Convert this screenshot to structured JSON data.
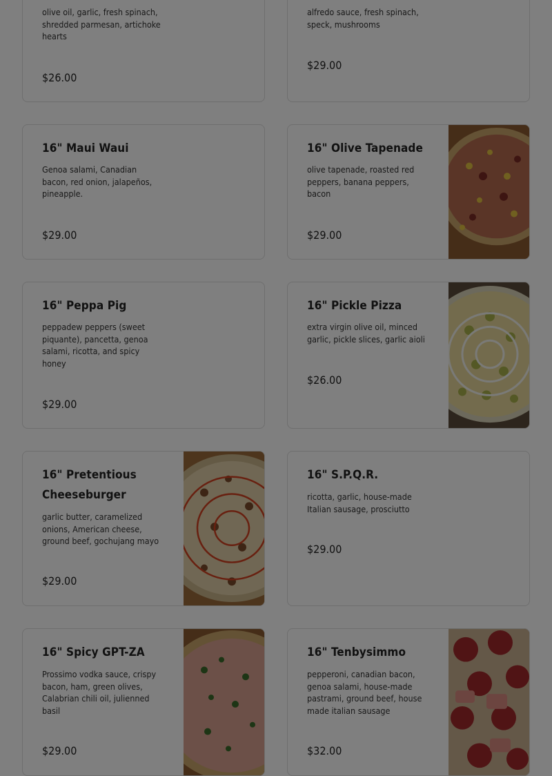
{
  "menu": {
    "items": [
      {
        "name": "",
        "description": "olive oil, garlic, fresh spinach, shredded parmesan, artichoke hearts",
        "price": "$26.00"
      },
      {
        "name": "",
        "description": "alfredo sauce, fresh spinach, speck, mushrooms",
        "price": "$29.00"
      },
      {
        "name": "16\" Maui Waui",
        "description": "Genoa salami, Canadian bacon, red onion, jalapeños, pineapple.",
        "price": "$29.00"
      },
      {
        "name": "16\" Olive Tapenade",
        "description": "olive tapenade, roasted red peppers, banana peppers, bacon",
        "price": "$29.00",
        "image": "pizza-photo"
      },
      {
        "name": "16\" Peppa Pig",
        "description": "peppadew peppers (sweet piquante), pancetta, genoa salami, ricotta, and spicy honey",
        "price": "$29.00"
      },
      {
        "name": "16\" Pickle Pizza",
        "description": "extra virgin olive oil, minced garlic, pickle slices, garlic aioli",
        "price": "$26.00",
        "image": "pizza-photo"
      },
      {
        "name": "16\" Pretentious Cheeseburger",
        "description": "garlic butter, caramelized onions, American cheese, ground beef, gochujang mayo",
        "price": "$29.00",
        "image": "pizza-photo"
      },
      {
        "name": "16\" S.P.Q.R.",
        "description": "ricotta, garlic, house-made Italian sausage, prosciutto",
        "price": "$29.00"
      },
      {
        "name": "16\" Spicy GPT-ZA",
        "description": "Prossimo vodka sauce, crispy bacon, ham, green olives, Calabrian chili oil, julienned basil",
        "price": "$29.00",
        "image": "pizza-photo"
      },
      {
        "name": "16\" Tenbysimmo",
        "description": "pepperoni, canadian bacon, genoa salami, house-made pastrami, ground beef, house made italian sausage",
        "price": "$32.00",
        "image": "pizza-photo"
      }
    ]
  },
  "overlay": {
    "color": "#000000",
    "opacity": 0.5
  }
}
